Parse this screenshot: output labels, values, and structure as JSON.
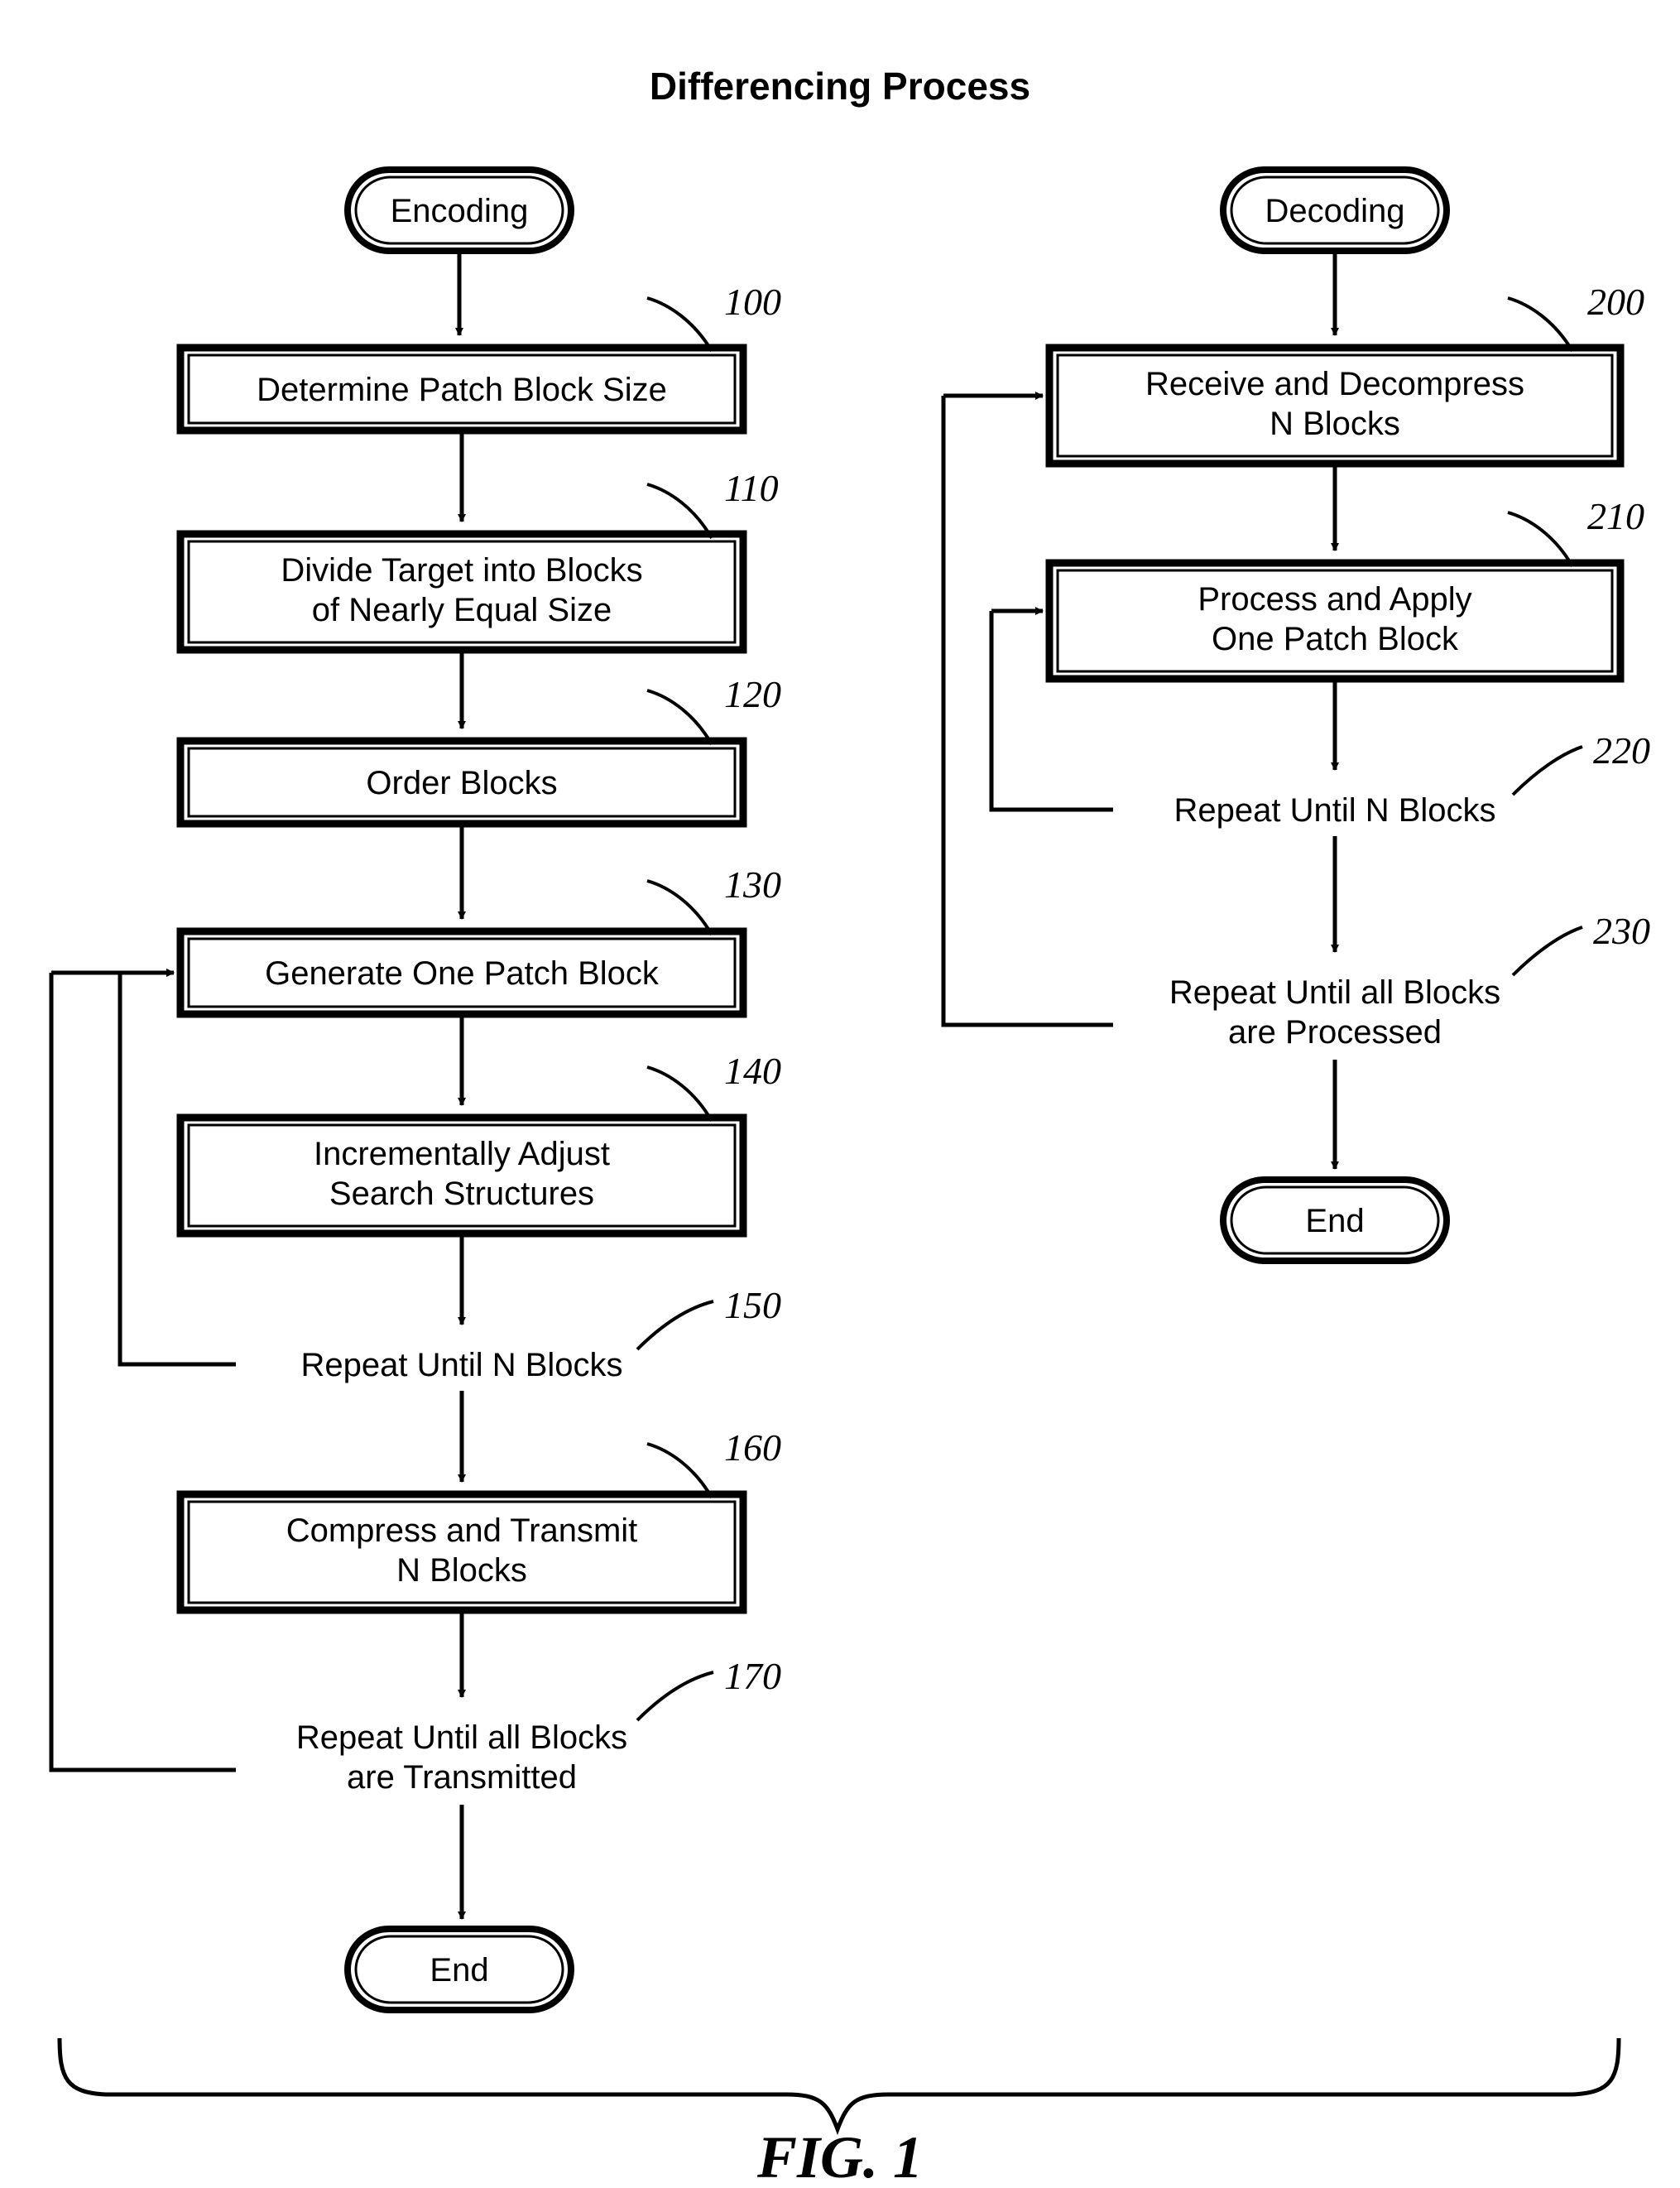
{
  "figure": {
    "title": "Differencing Process",
    "caption": "FIG. 1"
  },
  "encoding_branch": {
    "start_terminal": "Encoding",
    "end_terminal": "End",
    "steps": [
      {
        "ref": "100",
        "text_line1": "Determine Patch Block Size",
        "text_line2": "",
        "kind": "box"
      },
      {
        "ref": "110",
        "text_line1": "Divide Target into Blocks",
        "text_line2": "of Nearly Equal Size",
        "kind": "box"
      },
      {
        "ref": "120",
        "text_line1": "Order Blocks",
        "text_line2": "",
        "kind": "box"
      },
      {
        "ref": "130",
        "text_line1": "Generate One Patch Block",
        "text_line2": "",
        "kind": "box"
      },
      {
        "ref": "140",
        "text_line1": "Incrementally Adjust",
        "text_line2": "Search Structures",
        "kind": "box"
      },
      {
        "ref": "150",
        "text_line1": "Repeat Until N Blocks",
        "text_line2": "",
        "kind": "loop"
      },
      {
        "ref": "160",
        "text_line1": "Compress and Transmit",
        "text_line2": "N Blocks",
        "kind": "box"
      },
      {
        "ref": "170",
        "text_line1": "Repeat Until all Blocks",
        "text_line2": "are Transmitted",
        "kind": "loop"
      }
    ]
  },
  "decoding_branch": {
    "start_terminal": "Decoding",
    "end_terminal": "End",
    "steps": [
      {
        "ref": "200",
        "text_line1": "Receive and Decompress",
        "text_line2": "N Blocks",
        "kind": "box"
      },
      {
        "ref": "210",
        "text_line1": "Process and Apply",
        "text_line2": "One Patch Block",
        "kind": "box"
      },
      {
        "ref": "220",
        "text_line1": "Repeat Until N Blocks",
        "text_line2": "",
        "kind": "loop"
      },
      {
        "ref": "230",
        "text_line1": "Repeat Until all Blocks",
        "text_line2": "are Processed",
        "kind": "loop"
      }
    ]
  },
  "colors": {
    "ink": "#000000",
    "paper": "#ffffff"
  }
}
